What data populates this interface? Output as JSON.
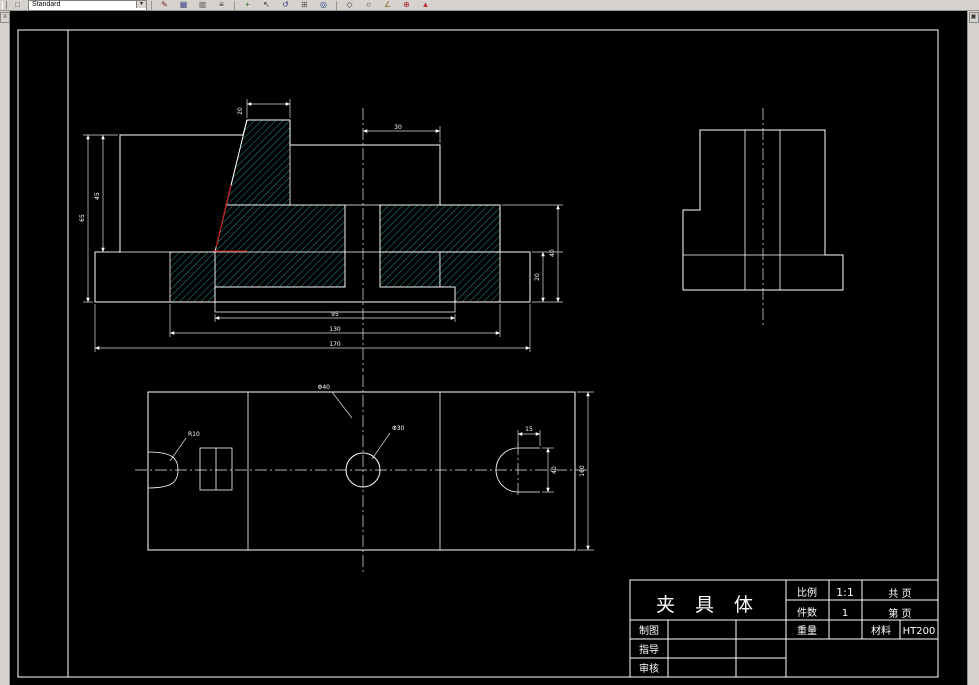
{
  "window": {
    "background": "#d6d3ce"
  },
  "toolbar": {
    "style_value": "Standard",
    "dropdown_arrow": "▾",
    "icons": [
      {
        "name": "new-file-icon",
        "glyph": "□",
        "css": "color:#444444"
      },
      {
        "name": "pencil-icon",
        "glyph": "✎",
        "css": "color:#8a2525"
      },
      {
        "name": "table-icon",
        "glyph": "▦",
        "css": "color:#44448a"
      },
      {
        "name": "palette-icon",
        "glyph": "▩",
        "css": "color:#777777"
      },
      {
        "name": "layers-icon",
        "glyph": "≡",
        "css": "color:#333333"
      },
      {
        "name": "plus-icon",
        "glyph": "+",
        "css": "color:#2a6a2a"
      },
      {
        "name": "cursor-icon",
        "glyph": "↖",
        "css": "color:#333333"
      },
      {
        "name": "undo-icon",
        "glyph": "↺",
        "css": "color:#333388"
      },
      {
        "name": "grid-icon",
        "glyph": "⊞",
        "css": "color:#555555"
      },
      {
        "name": "zoom-icon",
        "glyph": "◎",
        "css": "color:#224488"
      },
      {
        "name": "osnap-icon",
        "glyph": "◇",
        "css": "color:#333333"
      },
      {
        "name": "circle-icon",
        "glyph": "○",
        "css": "color:#333333"
      },
      {
        "name": "angle-icon",
        "glyph": "∠",
        "css": "color:#8a6a2a"
      },
      {
        "name": "target-icon",
        "glyph": "⊕",
        "css": "color:#aa2222"
      },
      {
        "name": "flag-icon",
        "glyph": "▲",
        "css": "color:#bb3333"
      }
    ]
  },
  "side_toolbars": {
    "left_handle_glyph": "≡",
    "right_handle_glyph": "▣"
  },
  "colors": {
    "canvas_bg": "#000000",
    "line": "#ffffff",
    "hatch": "#2f9e9e",
    "accent_red": "#c00000",
    "toolbar_bg": "#d6d3ce"
  },
  "title_block": {
    "part_name": "夹 具 体",
    "scale_label": "比例",
    "scale_value": "1:1",
    "pages_label": "共  页",
    "qty_label": "件数",
    "qty_value": "1",
    "page_label": "第  页",
    "drawn_label": "制图",
    "guide_label": "指导",
    "check_label": "审核",
    "weight_label": "重量",
    "material_label": "材料",
    "material_value": "HT200"
  },
  "dims": {
    "front": {
      "boss_width": "20",
      "top_right": "30",
      "left_outer": "65",
      "left_inner": "45",
      "right_inner": "20",
      "right_outer": "40",
      "bottom_inner": "95",
      "bottom_mid": "130",
      "bottom_outer": "170"
    },
    "plan": {
      "circle_dia": "Φ30",
      "upper_leader": "Φ40",
      "notch_radius": "R10",
      "slot_width": "15",
      "slot_height": "40",
      "right_side": "160"
    }
  }
}
